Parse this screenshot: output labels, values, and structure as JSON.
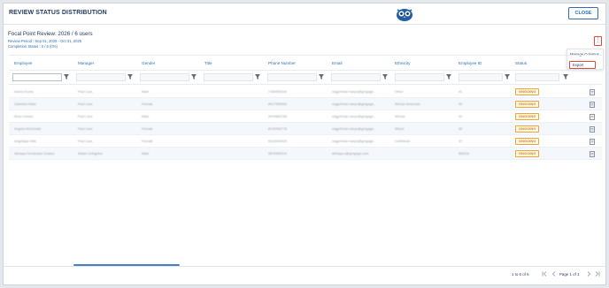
{
  "header": {
    "title": "REVIEW STATUS DISTRIBUTION",
    "close_label": "CLOSE"
  },
  "summary": {
    "heading": "Focal Point Review: 2026 / 6 users",
    "period": "Review Period : Sep 01, 2025 - Oct 31, 2025",
    "completion": "Completion Status : 0 / 6 (0%)"
  },
  "menu": {
    "kebab": "⋮",
    "manage_columns": "Manage Columns",
    "export": "Export"
  },
  "table": {
    "columns": [
      "Employee",
      "Manager",
      "Gender",
      "Title",
      "Phone Number",
      "Email",
      "Ethnicity",
      "Employee ID",
      "Status"
    ],
    "rows": [
      {
        "employee": "Debra Evans",
        "manager": "Paul Lara",
        "gender": "Male",
        "title": "",
        "phone": "7284555034",
        "email": "nagprimas+zaryo@gmgage...",
        "ethnicity": "Other",
        "id": "41",
        "status": "ONGOING"
      },
      {
        "employee": "Gabriela Hicks",
        "manager": "Paul Lara",
        "gender": "Female",
        "title": "",
        "phone": "8017555953",
        "email": "nagprimas+zaryo@gmgage...",
        "ethnicity": "African American",
        "id": "40",
        "status": "ONGOING"
      },
      {
        "employee": "Brian Howes",
        "manager": "Paul Lara",
        "gender": "Male",
        "title": "",
        "phone": "9044883765",
        "email": "nagprimas+zaryo@gmgage...",
        "ethnicity": "African",
        "id": "42",
        "status": "ONGOING"
      },
      {
        "employee": "Angela McDonald",
        "manager": "Paul Lara",
        "gender": "Female",
        "title": "",
        "phone": "8142052778",
        "email": "nagprimas+zaryo@gmgage...",
        "ethnicity": "Mixed",
        "id": "39",
        "status": "ONGOING"
      },
      {
        "employee": "Angelique Ellis",
        "manager": "Paul Lara",
        "gender": "Female",
        "title": "",
        "phone": "6318930924",
        "email": "nagprimas+zaryo@gmgage...",
        "ethnicity": "Caribbean",
        "id": "37",
        "status": "ONGOING"
      },
      {
        "employee": "Abhaya Fernandes Ooates",
        "manager": "Aidan Livingston",
        "gender": "Male",
        "title": "",
        "phone": "9870492024",
        "email": "abhaya.o@gmgage.com",
        "ethnicity": "",
        "id": "850211",
        "status": "ONGOING"
      }
    ]
  },
  "pagination": {
    "range": "1 to 6 of 6",
    "page": "Page 1 of 1"
  },
  "colors": {
    "accent": "#2f6fb0",
    "status_ongoing": "#f0a534",
    "highlight": "#e0493a"
  }
}
